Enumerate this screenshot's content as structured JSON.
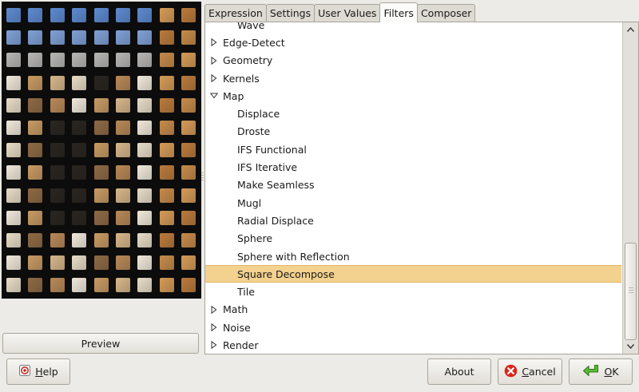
{
  "tabs": [
    {
      "label": "Expression",
      "active": false
    },
    {
      "label": "Settings",
      "active": false
    },
    {
      "label": "User Values",
      "active": false
    },
    {
      "label": "Filters",
      "active": true
    },
    {
      "label": "Composer",
      "active": false
    }
  ],
  "tree": {
    "rows": [
      {
        "label": "Wave",
        "level": 1,
        "expander": "none",
        "selected": false
      },
      {
        "label": "Edge-Detect",
        "level": 0,
        "expander": "collapsed",
        "selected": false
      },
      {
        "label": "Geometry",
        "level": 0,
        "expander": "collapsed",
        "selected": false
      },
      {
        "label": "Kernels",
        "level": 0,
        "expander": "collapsed",
        "selected": false
      },
      {
        "label": "Map",
        "level": 0,
        "expander": "expanded",
        "selected": false
      },
      {
        "label": "Displace",
        "level": 1,
        "expander": "none",
        "selected": false
      },
      {
        "label": "Droste",
        "level": 1,
        "expander": "none",
        "selected": false
      },
      {
        "label": "IFS Functional",
        "level": 1,
        "expander": "none",
        "selected": false
      },
      {
        "label": "IFS Iterative",
        "level": 1,
        "expander": "none",
        "selected": false
      },
      {
        "label": "Make Seamless",
        "level": 1,
        "expander": "none",
        "selected": false
      },
      {
        "label": "Mugl",
        "level": 1,
        "expander": "none",
        "selected": false
      },
      {
        "label": "Radial Displace",
        "level": 1,
        "expander": "none",
        "selected": false
      },
      {
        "label": "Sphere",
        "level": 1,
        "expander": "none",
        "selected": false
      },
      {
        "label": "Sphere with Reflection",
        "level": 1,
        "expander": "none",
        "selected": false
      },
      {
        "label": "Square Decompose",
        "level": 1,
        "expander": "none",
        "selected": true
      },
      {
        "label": "Tile",
        "level": 1,
        "expander": "none",
        "selected": false
      },
      {
        "label": "Math",
        "level": 0,
        "expander": "collapsed",
        "selected": false
      },
      {
        "label": "Noise",
        "level": 0,
        "expander": "collapsed",
        "selected": false
      },
      {
        "label": "Render",
        "level": 0,
        "expander": "collapsed",
        "selected": false
      }
    ]
  },
  "preview": {
    "button_label": "Preview"
  },
  "buttons": {
    "help": {
      "label": "Help",
      "mnemonic": "H",
      "rest": "elp",
      "icon": "help-icon"
    },
    "about": {
      "label": "About"
    },
    "cancel": {
      "label": "Cancel",
      "mnemonic": "C",
      "rest": "ancel",
      "icon": "cancel-icon"
    },
    "ok": {
      "label": "OK",
      "mnemonic": "O",
      "rest": "K",
      "icon": "ok-arrow-icon"
    }
  },
  "colors": {
    "selection": "#f3d18e",
    "cancel_red": "#d8261c",
    "ok_green": "#4aa526"
  }
}
